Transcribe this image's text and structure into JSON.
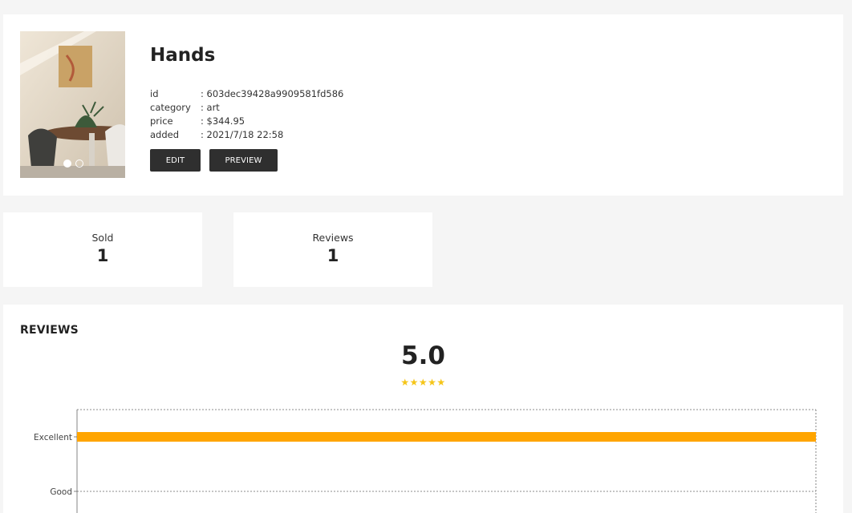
{
  "product": {
    "title": "Hands",
    "fields": [
      {
        "key": "id",
        "value": ": 603dec39428a9909581fd586"
      },
      {
        "key": "category",
        "value": ": art"
      },
      {
        "key": "price",
        "value": ": $344.95"
      },
      {
        "key": "added",
        "value": ": 2021/7/18 22:58"
      }
    ],
    "buttons": {
      "edit": "EDIT",
      "preview": "PREVIEW"
    },
    "carousel": {
      "count": 2,
      "active_index": 0
    }
  },
  "stats": {
    "sold": {
      "label": "Sold",
      "value": "1"
    },
    "reviews": {
      "label": "Reviews",
      "value": "1"
    }
  },
  "reviews": {
    "heading": "REVIEWS",
    "average": "5.0",
    "stars": "★★★★★",
    "star_count": 5,
    "colors": {
      "star": "#f5c518",
      "bar": "#ffa500"
    }
  },
  "chart_data": {
    "type": "bar",
    "orientation": "horizontal",
    "categories": [
      "Excellent",
      "Good"
    ],
    "values": [
      1,
      0
    ],
    "xlim": [
      0,
      1
    ],
    "grid": true
  }
}
